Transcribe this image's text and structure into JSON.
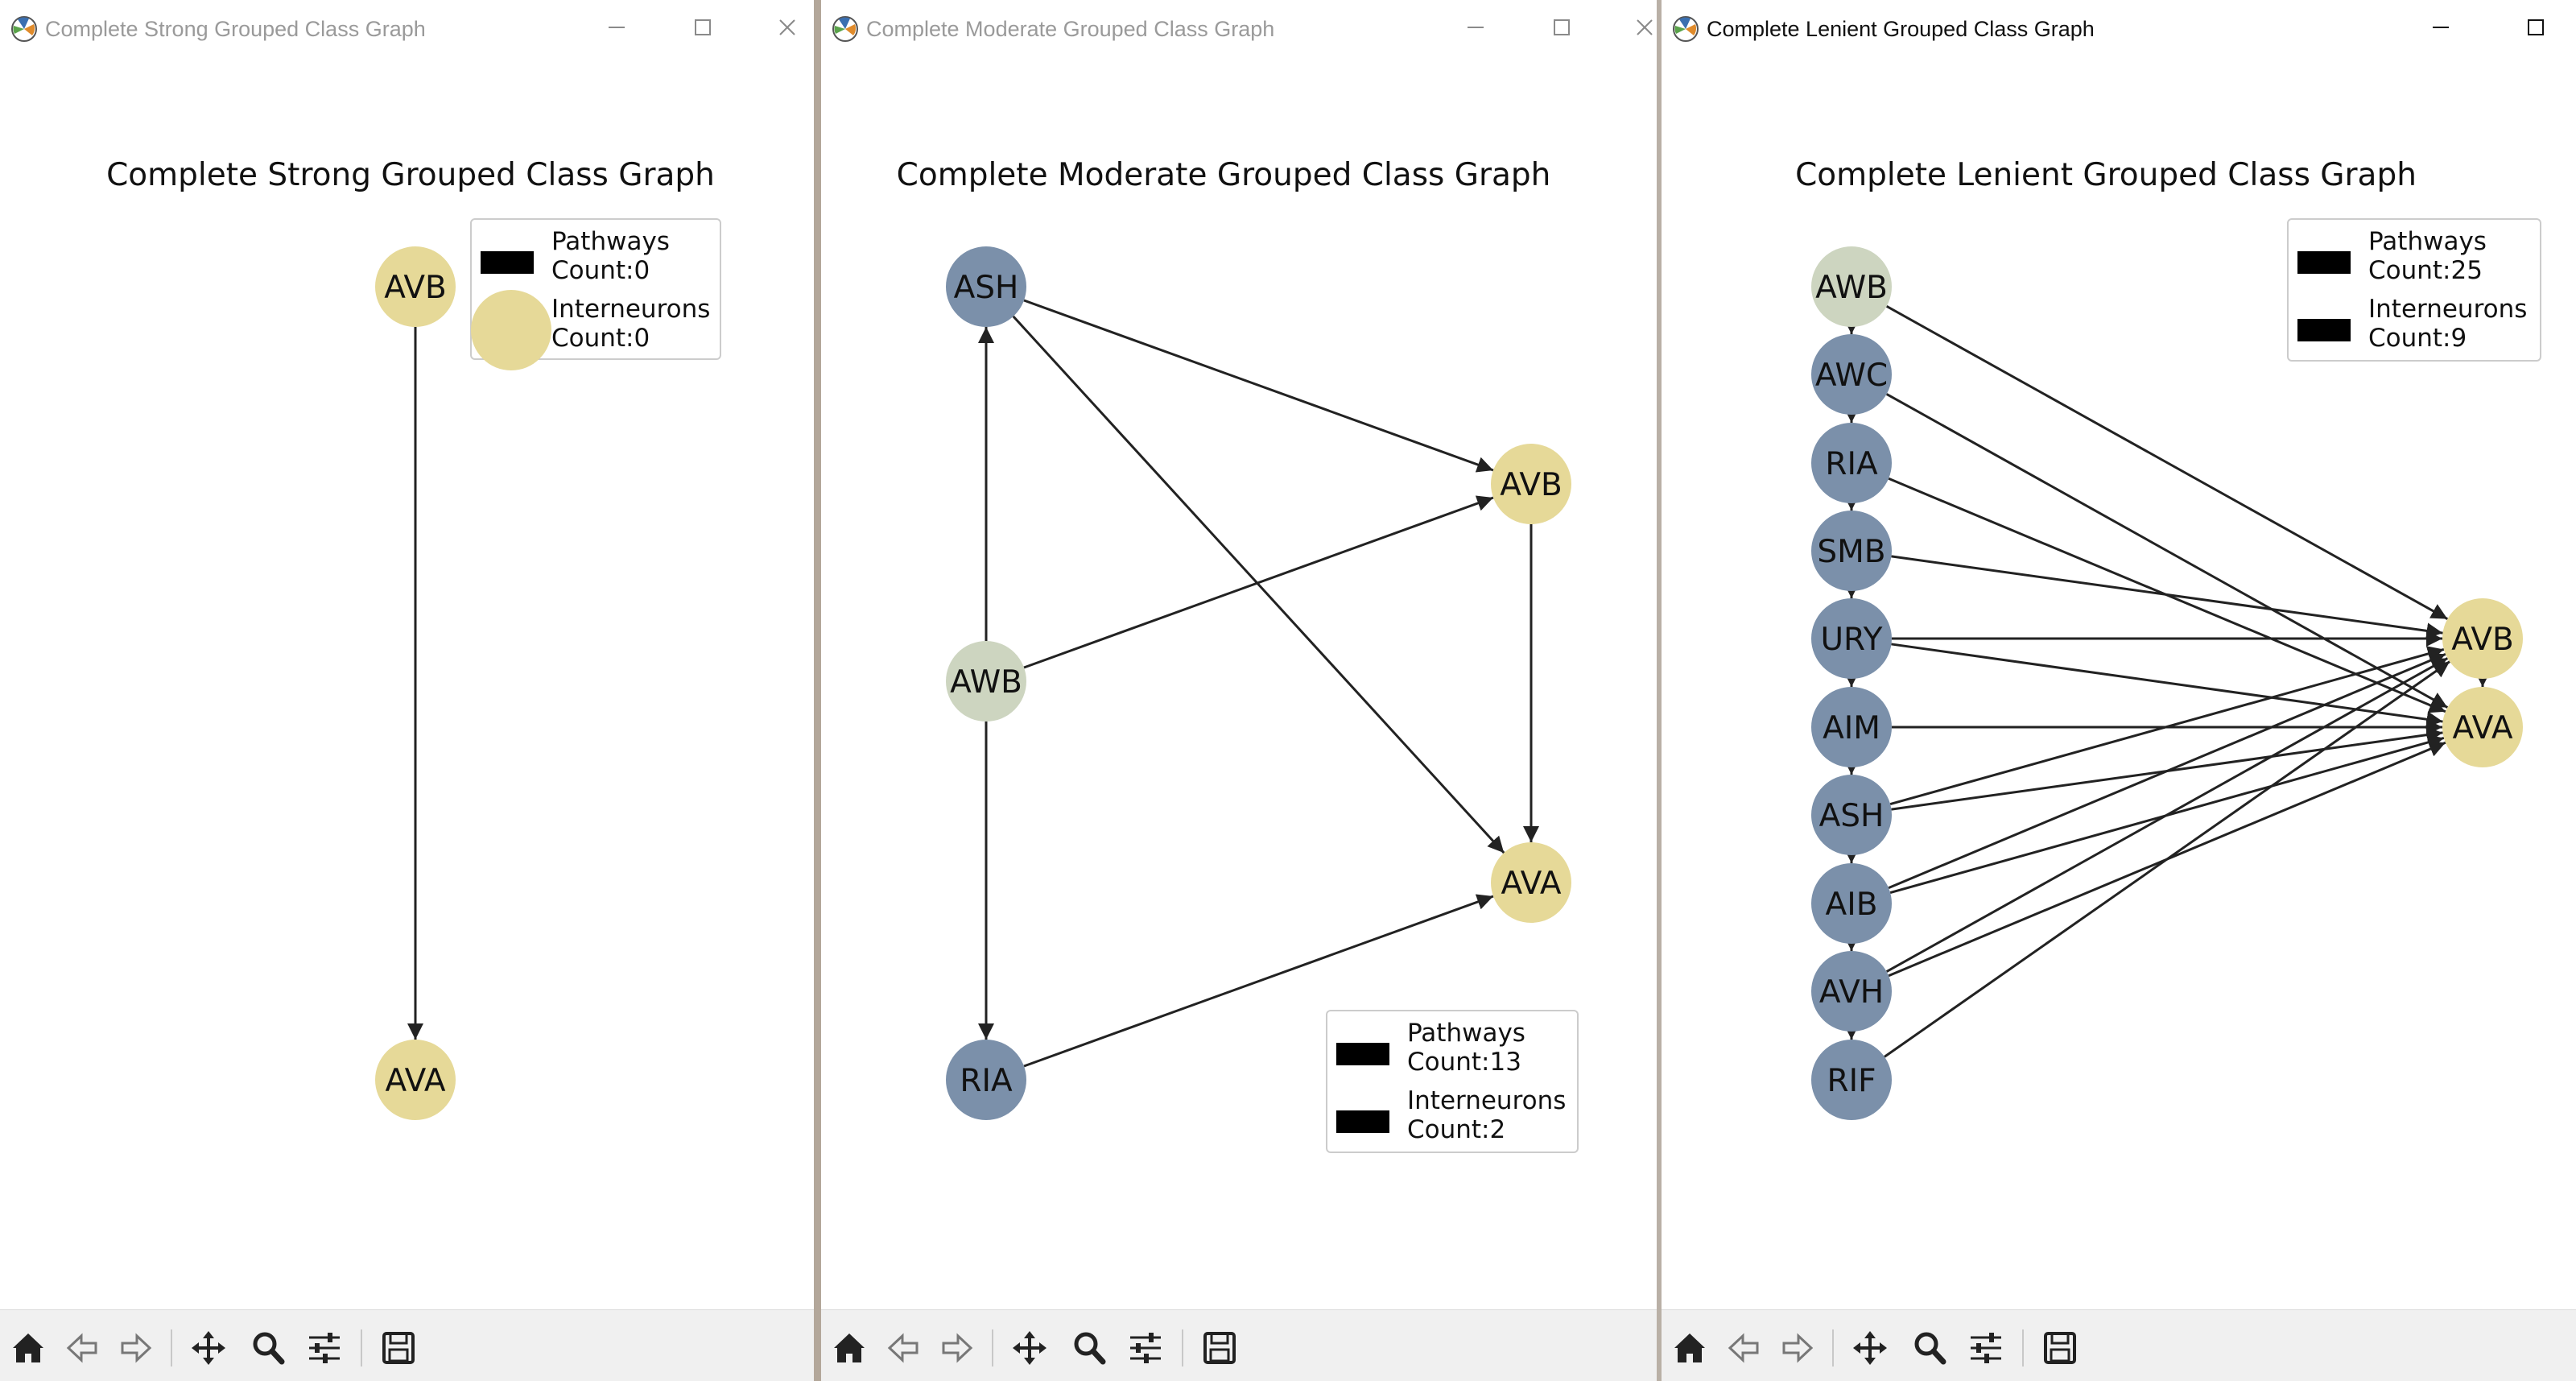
{
  "windows": [
    {
      "id": "strong",
      "title": "Complete Strong Grouped Class Graph",
      "has_close": true,
      "active": false,
      "chart_data": {
        "type": "network",
        "title": "Complete Strong Grouped Class Graph",
        "nodes": [
          {
            "label": "AVB",
            "kind": "interneuron",
            "color": "#e6d998"
          },
          {
            "label": "AVA",
            "kind": "interneuron",
            "color": "#e6d998"
          }
        ],
        "edges": [
          {
            "from": "AVB",
            "to": "AVA"
          }
        ],
        "legend": {
          "placement": "upper-right",
          "entries": [
            {
              "label": "Pathways\nCount:0",
              "marker": "bar",
              "color": "#000000"
            },
            {
              "label": "Interneurons\nCount:0",
              "marker": "circle",
              "color": "#e6d998"
            }
          ]
        }
      }
    },
    {
      "id": "moderate",
      "title": "Complete Moderate Grouped Class Graph",
      "has_close": true,
      "active": false,
      "chart_data": {
        "type": "network",
        "title": "Complete Moderate Grouped Class Graph",
        "nodes": [
          {
            "label": "ASH",
            "kind": "sensory",
            "color": "#7b90aa"
          },
          {
            "label": "AWB",
            "kind": "sensory-start",
            "color": "#cdd5c0"
          },
          {
            "label": "RIA",
            "kind": "sensory",
            "color": "#7b90aa"
          },
          {
            "label": "AVB",
            "kind": "interneuron",
            "color": "#e6d998"
          },
          {
            "label": "AVA",
            "kind": "interneuron",
            "color": "#e6d998"
          }
        ],
        "edges": [
          {
            "from": "ASH",
            "to": "AVB"
          },
          {
            "from": "ASH",
            "to": "AVA"
          },
          {
            "from": "AWB",
            "to": "ASH"
          },
          {
            "from": "AWB",
            "to": "AVB"
          },
          {
            "from": "AWB",
            "to": "RIA"
          },
          {
            "from": "AVB",
            "to": "AVA"
          },
          {
            "from": "RIA",
            "to": "AVA"
          }
        ],
        "legend": {
          "placement": "lower-right",
          "entries": [
            {
              "label": "Pathways\nCount:13",
              "marker": "bar",
              "color": "#000000"
            },
            {
              "label": "Interneurons\nCount:2",
              "marker": "bar",
              "color": "#000000"
            }
          ]
        }
      }
    },
    {
      "id": "lenient",
      "title": "Complete Lenient Grouped Class Graph",
      "has_close": false,
      "active": true,
      "chart_data": {
        "type": "network",
        "title": "Complete Lenient Grouped Class Graph",
        "nodes": [
          {
            "label": "AWB",
            "kind": "sensory-start",
            "color": "#cdd5c0"
          },
          {
            "label": "AWC",
            "kind": "sensory",
            "color": "#7b90aa"
          },
          {
            "label": "RIA",
            "kind": "sensory",
            "color": "#7b90aa"
          },
          {
            "label": "SMB",
            "kind": "sensory",
            "color": "#7b90aa"
          },
          {
            "label": "URY",
            "kind": "sensory",
            "color": "#7b90aa"
          },
          {
            "label": "AIM",
            "kind": "sensory",
            "color": "#7b90aa"
          },
          {
            "label": "ASH",
            "kind": "sensory",
            "color": "#7b90aa"
          },
          {
            "label": "AIB",
            "kind": "sensory",
            "color": "#7b90aa"
          },
          {
            "label": "AVH",
            "kind": "sensory",
            "color": "#7b90aa"
          },
          {
            "label": "RIF",
            "kind": "sensory",
            "color": "#7b90aa"
          },
          {
            "label": "AVB",
            "kind": "interneuron",
            "color": "#e6d998"
          },
          {
            "label": "AVA",
            "kind": "interneuron",
            "color": "#e6d998"
          }
        ],
        "edges": [
          {
            "from": "AWB",
            "to": "AVB"
          },
          {
            "from": "AWC",
            "to": "AVA"
          },
          {
            "from": "RIA",
            "to": "AVA"
          },
          {
            "from": "SMB",
            "to": "AVB"
          },
          {
            "from": "URY",
            "to": "AVB"
          },
          {
            "from": "URY",
            "to": "AVA"
          },
          {
            "from": "AIM",
            "to": "AVA"
          },
          {
            "from": "ASH",
            "to": "AVB"
          },
          {
            "from": "ASH",
            "to": "AVA"
          },
          {
            "from": "AIB",
            "to": "AVB"
          },
          {
            "from": "AIB",
            "to": "AVA"
          },
          {
            "from": "AVH",
            "to": "AVB"
          },
          {
            "from": "AVH",
            "to": "AVA"
          },
          {
            "from": "RIF",
            "to": "AVB"
          },
          {
            "from": "AWB",
            "to": "AWC"
          },
          {
            "from": "AWC",
            "to": "RIA"
          },
          {
            "from": "RIA",
            "to": "SMB"
          },
          {
            "from": "SMB",
            "to": "URY"
          },
          {
            "from": "URY",
            "to": "AIM"
          },
          {
            "from": "AIM",
            "to": "ASH"
          },
          {
            "from": "ASH",
            "to": "AIB"
          },
          {
            "from": "AIB",
            "to": "AVH"
          },
          {
            "from": "AVH",
            "to": "RIF"
          },
          {
            "from": "AVB",
            "to": "AVA"
          }
        ],
        "legend": {
          "placement": "upper-right",
          "entries": [
            {
              "label": "Pathways\nCount:25",
              "marker": "bar",
              "color": "#000000"
            },
            {
              "label": "Interneurons\nCount:9",
              "marker": "bar",
              "color": "#000000"
            }
          ]
        }
      }
    }
  ],
  "toolbar": {
    "buttons": [
      {
        "name": "home-icon"
      },
      {
        "name": "back-arrow-icon"
      },
      {
        "name": "forward-arrow-icon"
      },
      {
        "name": "pan-icon"
      },
      {
        "name": "zoom-icon"
      },
      {
        "name": "configure-subplots-icon"
      },
      {
        "name": "save-icon"
      }
    ]
  },
  "colors": {
    "sensory": "#7b90aa",
    "sensory_start": "#cdd5c0",
    "interneuron": "#e6d998",
    "edge": "#222222"
  }
}
